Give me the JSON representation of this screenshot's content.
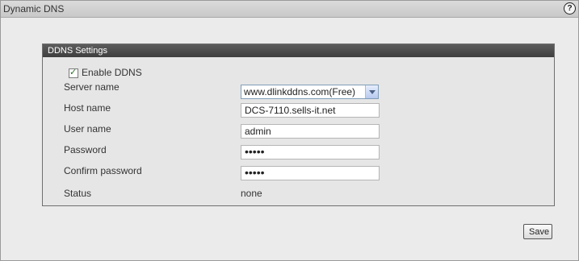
{
  "window": {
    "title": "Dynamic DNS",
    "help_icon": "question-icon"
  },
  "panel": {
    "header": "DDNS Settings",
    "enable": {
      "label": "Enable DDNS",
      "checked": true
    },
    "fields": {
      "server_name": {
        "label": "Server name",
        "value": "www.dlinkddns.com(Free)"
      },
      "host_name": {
        "label": "Host name",
        "value": "DCS-7110.sells-it.net"
      },
      "user_name": {
        "label": "User name",
        "value": "admin"
      },
      "password": {
        "label": "Password",
        "value": "•••••"
      },
      "confirm_password": {
        "label": "Confirm password",
        "value": "•••••"
      },
      "status": {
        "label": "Status",
        "value": "none"
      }
    }
  },
  "actions": {
    "save_label": "Save"
  }
}
